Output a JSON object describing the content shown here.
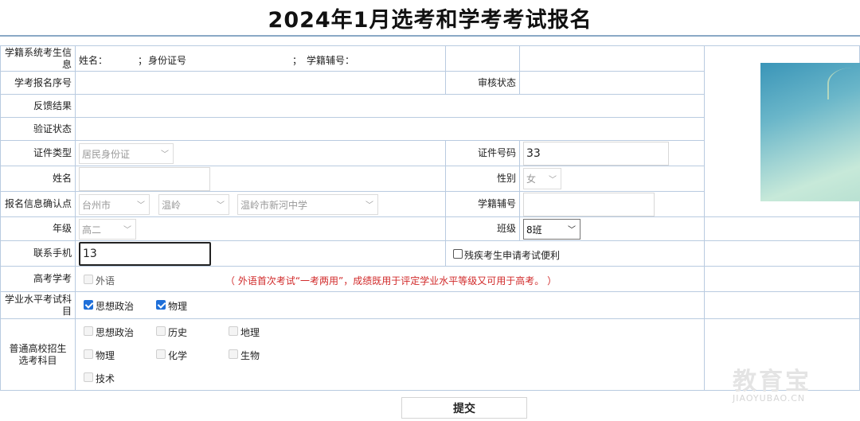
{
  "page_title": "2024年1月选考和学考考试报名",
  "rows": {
    "student_info": {
      "label": "学籍系统考生信息",
      "name_label": "姓名：",
      "sep1": "；",
      "id_label": "身份证号",
      "sep2": "；",
      "reg_label": "学籍辅号："
    },
    "seq": {
      "label": "学考报名序号",
      "review_label": "审核状态"
    },
    "feedback": {
      "label": "反馈结果"
    },
    "verify": {
      "label": "验证状态"
    },
    "id_type": {
      "label": "证件类型",
      "value": "居民身份证",
      "number_label": "证件号码",
      "number_value": "33"
    },
    "name": {
      "label": "姓名",
      "value": "",
      "gender_label": "性别",
      "gender_value": "女"
    },
    "confirm_point": {
      "label": "报名信息确认点",
      "city": "台州市",
      "district": "温岭",
      "school": "温岭市新河中学",
      "reg_label": "学籍辅号"
    },
    "grade": {
      "label": "年级",
      "value": "高二",
      "class_label": "班级",
      "class_value": "8班"
    },
    "phone": {
      "label": "联系手机",
      "value": "13",
      "disability_label": "残疾考生申请考试便利"
    },
    "gaokao": {
      "label": "高考学考",
      "foreign_label": "外语",
      "note": "（ 外语首次考试“一考两用”，成绩既用于评定学业水平等级又可用于高考。 ）"
    },
    "academic": {
      "label": "学业水平考试科目",
      "subjects": [
        "思想政治",
        "物理"
      ]
    },
    "elective": {
      "label": "普通高校招生选考科目",
      "subjects": [
        "思想政治",
        "历史",
        "地理",
        "物理",
        "化学",
        "生物",
        "技术"
      ]
    }
  },
  "submit_label": "提交",
  "watermark": {
    "main": "教育宝",
    "sub": "JIAOYUBAO.CN"
  },
  "colors": {
    "border": "#b9cbe0",
    "accent_check": "#1e6fd9",
    "note_red": "#d12a2a"
  }
}
